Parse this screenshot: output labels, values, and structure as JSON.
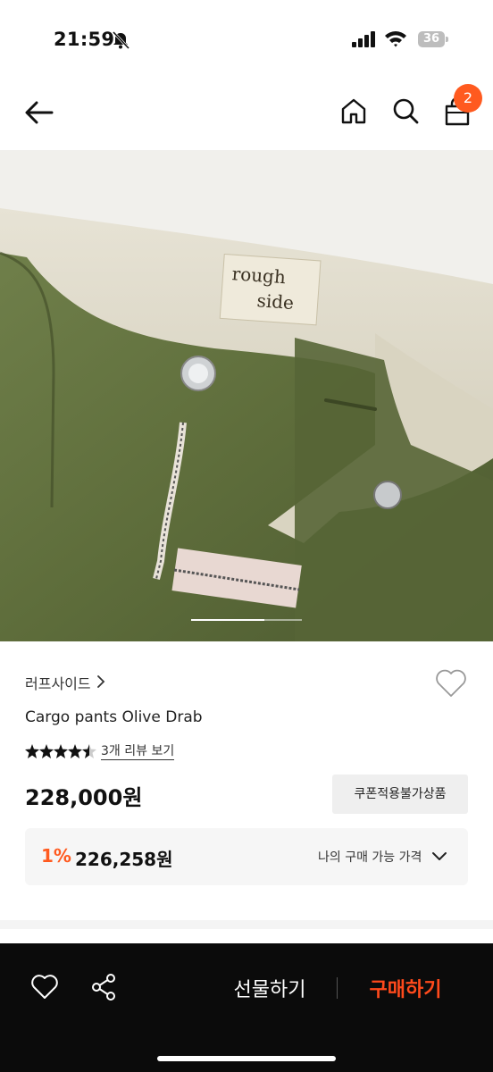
{
  "status_bar": {
    "time": "21:59",
    "battery": "36"
  },
  "nav": {
    "cart_count": "2"
  },
  "product": {
    "image_label_line1": "rough",
    "image_label_line2": "side",
    "brand": "러프사이드",
    "title": "Cargo pants Olive Drab",
    "rating_stars": 4.5,
    "review_link": "3개 리뷰 보기",
    "price": "228,000원",
    "coupon_button": "쿠폰적용불가상품",
    "my_price": {
      "percent": "1%",
      "price": "226,258원",
      "label": "나의 구매 가능 가격"
    }
  },
  "bottom_bar": {
    "gift_label": "선물하기",
    "buy_label": "구매하기"
  },
  "colors": {
    "accent": "#ff5a1f",
    "buy": "#ff4a1c",
    "bar_bg": "#0b0b0b"
  }
}
